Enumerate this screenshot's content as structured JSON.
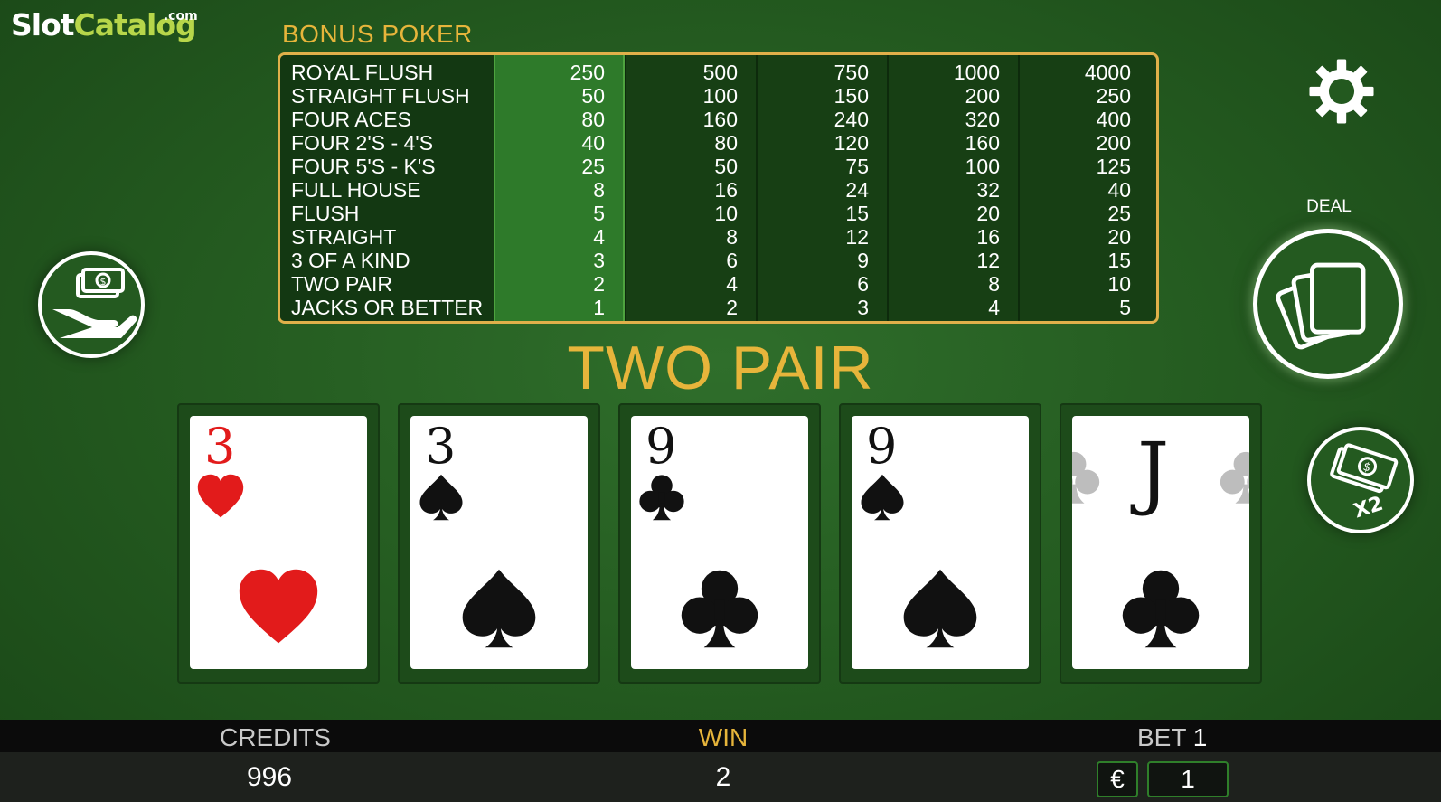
{
  "logo": {
    "part1": "Slot",
    "part2": "Catalog",
    "suffix": ".com"
  },
  "game_title": "BONUS POKER",
  "paytable": {
    "hands": [
      "ROYAL FLUSH",
      "STRAIGHT FLUSH",
      "FOUR ACES",
      "FOUR 2'S - 4'S",
      "FOUR 5'S - K'S",
      "FULL HOUSE",
      "FLUSH",
      "STRAIGHT",
      "3 OF A KIND",
      "TWO PAIR",
      "JACKS OR BETTER"
    ],
    "columns": [
      [
        "250",
        "50",
        "80",
        "40",
        "25",
        "8",
        "5",
        "4",
        "3",
        "2",
        "1"
      ],
      [
        "500",
        "100",
        "160",
        "80",
        "50",
        "16",
        "10",
        "8",
        "6",
        "4",
        "2"
      ],
      [
        "750",
        "150",
        "240",
        "120",
        "75",
        "24",
        "15",
        "12",
        "9",
        "6",
        "3"
      ],
      [
        "1000",
        "200",
        "320",
        "160",
        "100",
        "32",
        "20",
        "16",
        "12",
        "8",
        "4"
      ],
      [
        "4000",
        "250",
        "400",
        "200",
        "125",
        "40",
        "25",
        "20",
        "15",
        "10",
        "5"
      ]
    ],
    "active_column": 0,
    "border_color": "#e0b04a",
    "active_color": "#2e7a2a"
  },
  "result_text": "TWO PAIR",
  "cards": [
    {
      "rank": "3",
      "suit": "hearts",
      "color": "red"
    },
    {
      "rank": "3",
      "suit": "spades",
      "color": "black"
    },
    {
      "rank": "9",
      "suit": "clubs",
      "color": "black"
    },
    {
      "rank": "9",
      "suit": "spades",
      "color": "black"
    },
    {
      "rank": "J",
      "suit": "clubs",
      "color": "black"
    }
  ],
  "buttons": {
    "deal_label": "DEAL",
    "collect_icon": "hand-money-icon",
    "double_icon": "money-x2-icon",
    "double_text": "X2",
    "settings_icon": "gear-icon"
  },
  "status": {
    "credits_label": "CREDITS",
    "credits_value": "996",
    "win_label": "WIN",
    "win_value": "2",
    "bet_label": "BET",
    "bet_value": "1",
    "currency_symbol": "€",
    "bet_box_value": "1"
  },
  "colors": {
    "accent_gold": "#e7b53b",
    "felt_green": "#23591f"
  }
}
